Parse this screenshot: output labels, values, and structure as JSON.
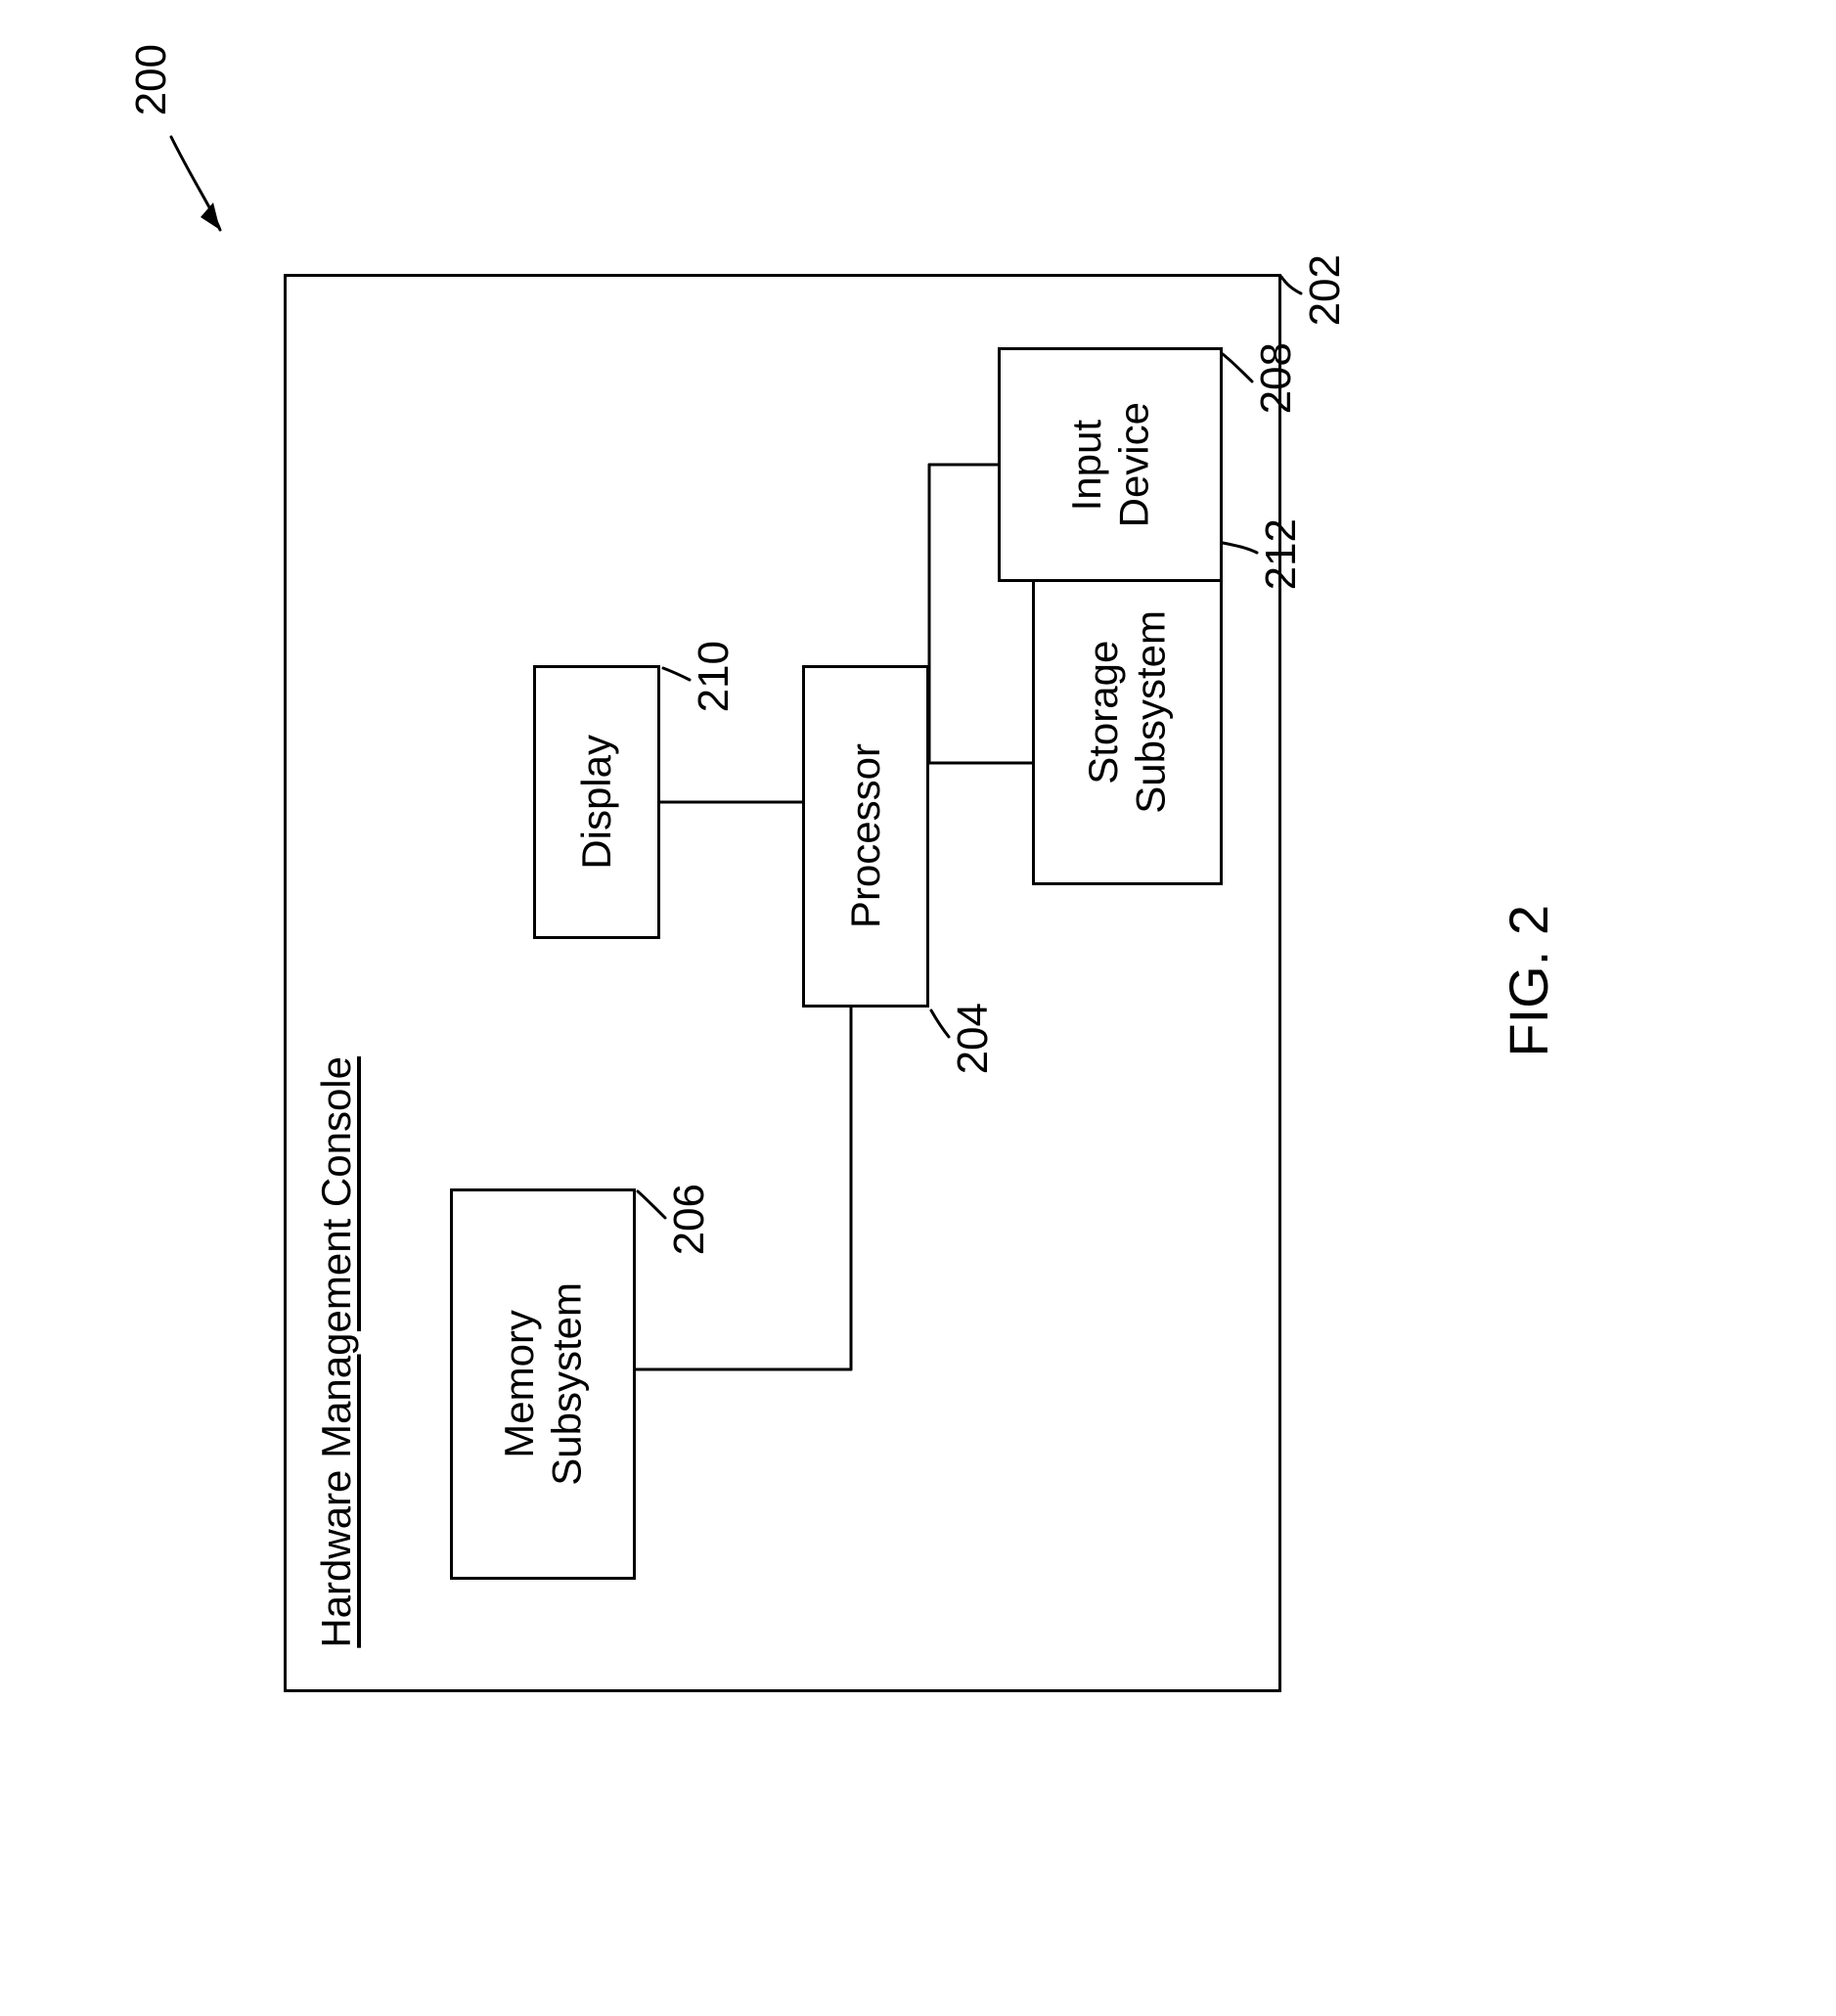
{
  "figure": {
    "number_ref": "200",
    "caption": "FIG. 2"
  },
  "container": {
    "title": "Hardware Management Console",
    "ref": "202"
  },
  "blocks": {
    "storage": {
      "label": "Storage\nSubsystem",
      "ref": "212"
    },
    "processor": {
      "label": "Processor",
      "ref": "204"
    },
    "memory": {
      "label": "Memory\nSubsystem",
      "ref": "206"
    },
    "input": {
      "label": "Input\nDevice",
      "ref": "208"
    },
    "display": {
      "label": "Display",
      "ref": "210"
    }
  }
}
